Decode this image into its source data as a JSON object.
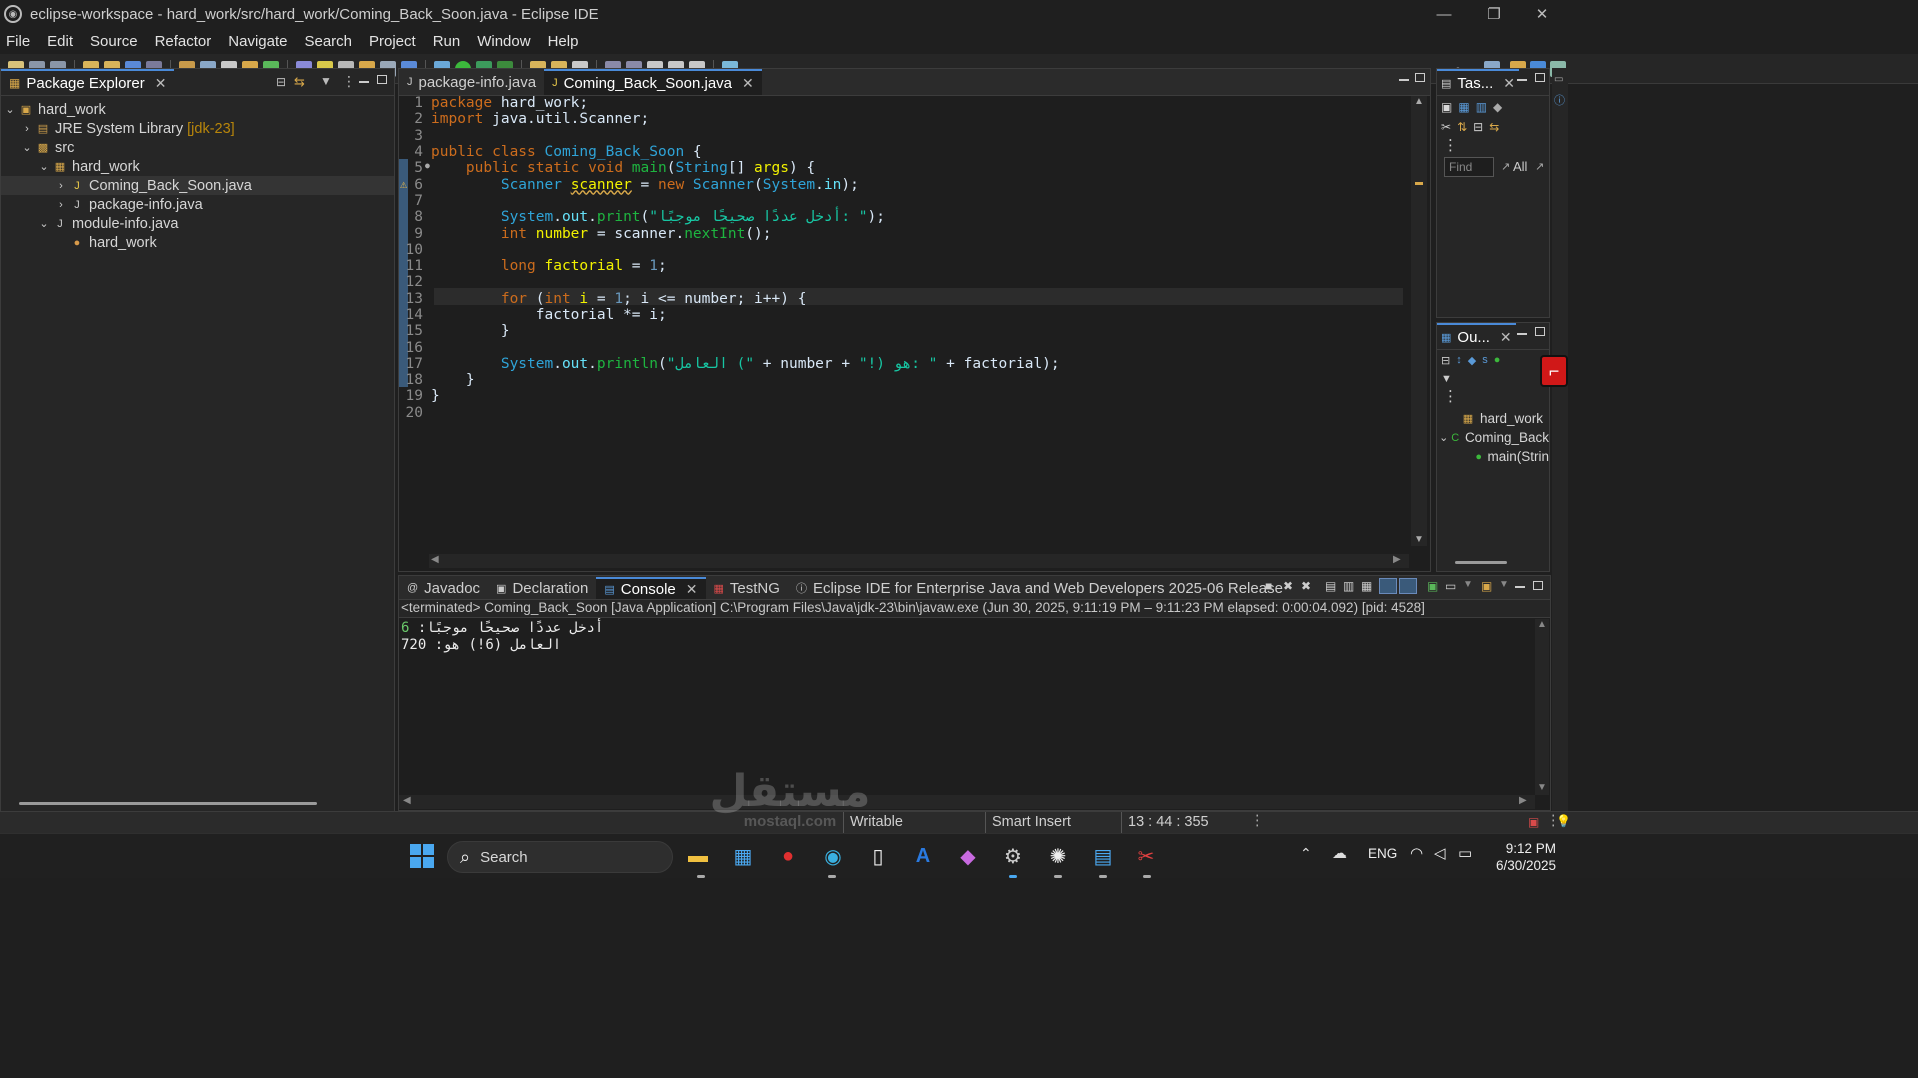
{
  "window": {
    "title": "eclipse-workspace - hard_work/src/hard_work/Coming_Back_Soon.java - Eclipse IDE",
    "minimize": "—",
    "restore": "❐",
    "close": "✕"
  },
  "menu": [
    "File",
    "Edit",
    "Source",
    "Refactor",
    "Navigate",
    "Search",
    "Project",
    "Run",
    "Window",
    "Help"
  ],
  "package_explorer": {
    "tab_label": "Package Explorer",
    "tree": [
      {
        "label": "hard_work",
        "twisty": "⌄",
        "icon": "project-icon"
      },
      {
        "label": "JRE System Library",
        "suffix": "[jdk-23]",
        "twisty": "›",
        "icon": "library-icon"
      },
      {
        "label": "src",
        "twisty": "⌄",
        "icon": "source-folder-icon"
      },
      {
        "label": "hard_work",
        "twisty": "⌄",
        "icon": "package-icon"
      },
      {
        "label": "Coming_Back_Soon.java",
        "twisty": "›",
        "icon": "java-file-icon"
      },
      {
        "label": "package-info.java",
        "twisty": "›",
        "icon": "java-file-icon"
      },
      {
        "label": "module-info.java",
        "twisty": "⌄",
        "icon": "java-file-icon"
      },
      {
        "label": "hard_work",
        "twisty": "",
        "icon": "module-icon"
      }
    ]
  },
  "editor": {
    "tabs": [
      {
        "label": "package-info.java",
        "active": false
      },
      {
        "label": "Coming_Back_Soon.java",
        "active": true
      }
    ],
    "line_numbers": [
      "1",
      "2",
      "3",
      "4",
      "5",
      "6",
      "7",
      "8",
      "9",
      "10",
      "11",
      "12",
      "13",
      "14",
      "15",
      "16",
      "17",
      "18",
      "19",
      "20"
    ],
    "lines": [
      [
        {
          "t": "package ",
          "c": "kw"
        },
        {
          "t": "hard_work;",
          "c": "pl"
        }
      ],
      [
        {
          "t": "import ",
          "c": "kw"
        },
        {
          "t": "java.util.Scanner;",
          "c": "pl"
        }
      ],
      [],
      [
        {
          "t": "public class ",
          "c": "kw"
        },
        {
          "t": "Coming_Back_Soon",
          "c": "cls"
        },
        {
          "t": " {",
          "c": "pl"
        }
      ],
      [
        {
          "t": "    public static void ",
          "c": "kw"
        },
        {
          "t": "main",
          "c": "ty"
        },
        {
          "t": "(",
          "c": "pl"
        },
        {
          "t": "String",
          "c": "cls"
        },
        {
          "t": "[] ",
          "c": "pl"
        },
        {
          "t": "args",
          "c": "var"
        },
        {
          "t": ") {",
          "c": "pl"
        }
      ],
      [
        {
          "t": "        Scanner ",
          "c": "cls"
        },
        {
          "t": "scanner",
          "c": "var"
        },
        {
          "t": " = ",
          "c": "pl"
        },
        {
          "t": "new ",
          "c": "kw"
        },
        {
          "t": "Scanner",
          "c": "cls"
        },
        {
          "t": "(",
          "c": "pl"
        },
        {
          "t": "System",
          "c": "cls"
        },
        {
          "t": ".",
          "c": "pl"
        },
        {
          "t": "in",
          "c": "fld"
        },
        {
          "t": ");",
          "c": "pl"
        }
      ],
      [],
      [
        {
          "t": "        System",
          "c": "cls"
        },
        {
          "t": ".",
          "c": "pl"
        },
        {
          "t": "out",
          "c": "fld"
        },
        {
          "t": ".",
          "c": "pl"
        },
        {
          "t": "print",
          "c": "ty"
        },
        {
          "t": "(",
          "c": "pl"
        },
        {
          "t": "\"أدخل عددًا صحيحًا موجبًا: \"",
          "c": "str"
        },
        {
          "t": ");",
          "c": "pl"
        }
      ],
      [
        {
          "t": "        int ",
          "c": "kw"
        },
        {
          "t": "number",
          "c": "var"
        },
        {
          "t": " = scanner.",
          "c": "pl"
        },
        {
          "t": "nextInt",
          "c": "ty"
        },
        {
          "t": "();",
          "c": "pl"
        }
      ],
      [],
      [
        {
          "t": "        long ",
          "c": "kw"
        },
        {
          "t": "factorial",
          "c": "var"
        },
        {
          "t": " = ",
          "c": "pl"
        },
        {
          "t": "1",
          "c": "num"
        },
        {
          "t": ";",
          "c": "pl"
        }
      ],
      [],
      [
        {
          "t": "        for ",
          "c": "kw"
        },
        {
          "t": "(",
          "c": "pl"
        },
        {
          "t": "int ",
          "c": "kw"
        },
        {
          "t": "i",
          "c": "var"
        },
        {
          "t": " = ",
          "c": "pl"
        },
        {
          "t": "1",
          "c": "num"
        },
        {
          "t": "; i <= number; i++) {",
          "c": "pl"
        }
      ],
      [
        {
          "t": "            factorial *= i;",
          "c": "pl"
        }
      ],
      [
        {
          "t": "        }",
          "c": "pl"
        }
      ],
      [],
      [
        {
          "t": "        System",
          "c": "cls"
        },
        {
          "t": ".",
          "c": "pl"
        },
        {
          "t": "out",
          "c": "fld"
        },
        {
          "t": ".",
          "c": "pl"
        },
        {
          "t": "println",
          "c": "ty"
        },
        {
          "t": "(",
          "c": "pl"
        },
        {
          "t": "\"العامل (\"",
          "c": "str"
        },
        {
          "t": " + number + ",
          "c": "pl"
        },
        {
          "t": "\"!) هو: \"",
          "c": "str"
        },
        {
          "t": " + factorial);",
          "c": "pl"
        }
      ],
      [
        {
          "t": "    }",
          "c": "pl"
        }
      ],
      [
        {
          "t": "}",
          "c": "pl"
        }
      ],
      []
    ]
  },
  "task_list": {
    "tab_label": "Tas...",
    "find_placeholder": "Find",
    "all_label": "All"
  },
  "outline": {
    "tab_label": "Ou...",
    "items": [
      {
        "label": "hard_work",
        "twisty": "",
        "icon": "package-icon"
      },
      {
        "label": "Coming_Back",
        "twisty": "⌄",
        "icon": "class-icon"
      },
      {
        "label": "main(Strin",
        "twisty": "",
        "icon": "method-icon"
      }
    ]
  },
  "bottom_panel": {
    "tabs": [
      {
        "label": "Javadoc",
        "icon": "javadoc-icon",
        "active": false
      },
      {
        "label": "Declaration",
        "icon": "declaration-icon",
        "active": false
      },
      {
        "label": "Console",
        "icon": "console-icon",
        "active": true
      },
      {
        "label": "TestNG",
        "icon": "testng-icon",
        "active": false
      },
      {
        "label": "Eclipse IDE for Enterprise Java and Web Developers 2025-06 Release",
        "icon": "info-icon",
        "active": false
      }
    ],
    "terminated_line": "<terminated> Coming_Back_Soon [Java Application] C:\\Program Files\\Java\\jdk-23\\bin\\javaw.exe  (Jun 30, 2025, 9:11:19 PM – 9:11:23 PM elapsed: 0:00:04.092) [pid: 4528]",
    "output": [
      {
        "text": "أدخل عددًا صحيحًا موجبًا: ",
        "input": "6"
      },
      {
        "text": "العامل (6!) هو: 720",
        "input": ""
      }
    ]
  },
  "status": {
    "writable": "Writable",
    "insert_mode": "Smart Insert",
    "position": "13 : 44 : 355"
  },
  "watermark": "مستقل mostaql.com",
  "taskbar": {
    "search_label": "Search",
    "lang": "ENG",
    "time": "9:12 PM",
    "date": "6/30/2025"
  },
  "colors": {
    "accent": "#4a8ad8",
    "keyword": "#cc6c1d",
    "string": "#17c6a3",
    "class": "#2fa4d8"
  }
}
